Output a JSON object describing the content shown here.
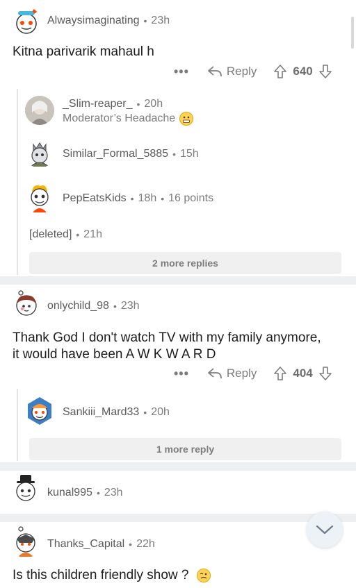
{
  "comments": [
    {
      "username": "Alwaysimaginating",
      "time": "23h",
      "body": "Kitna parivarik mahaul h",
      "reply_label": "Reply",
      "votes": "640",
      "replies": [
        {
          "username": "_Slim-reaper_",
          "time": "20h",
          "flair": "Moderator’s Headache"
        },
        {
          "username": "Similar_Formal_5885",
          "time": "15h"
        },
        {
          "username": "PepEatsKids",
          "time": "18h",
          "points": "16 points"
        },
        {
          "username": "[deleted]",
          "time": "21h"
        }
      ],
      "more_replies": "2 more replies"
    },
    {
      "username": "onlychild_98",
      "time": "23h",
      "body_line1": "Thank God I don't watch TV with my family anymore,",
      "body_line2": "it would have been A W K W A R D",
      "reply_label": "Reply",
      "votes": "404",
      "replies": [
        {
          "username": "Sankiii_Mard33",
          "time": "20h"
        }
      ],
      "more_replies": "1 more reply"
    },
    {
      "username": "kunal995",
      "time": "23h"
    },
    {
      "username": "Thanks_Capital",
      "time": "22h",
      "body": "Is this children friendly show ?"
    }
  ],
  "separator": "•",
  "ellipsis": "•••",
  "colors": {
    "divider": "#edeff1",
    "text": "#1c1c1c",
    "muted": "#7c7c7c",
    "accent": "#ff4500"
  }
}
